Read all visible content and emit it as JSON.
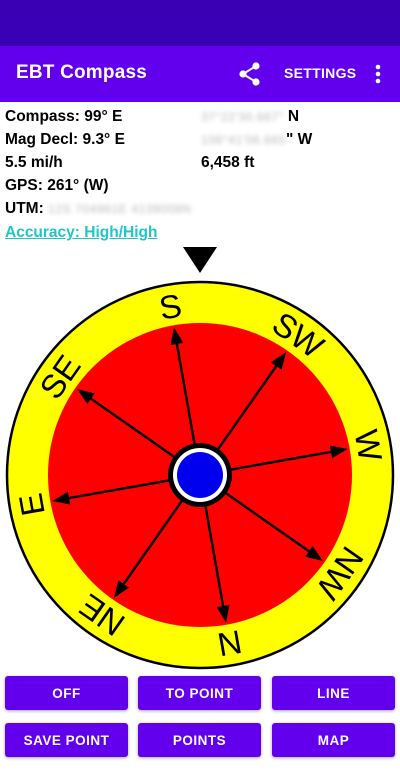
{
  "app": {
    "title": "EBT Compass"
  },
  "toolbar": {
    "settings_label": "SETTINGS",
    "share_icon": "share-icon",
    "more_icon": "more-vert-icon"
  },
  "info": {
    "compass": "Compass: 99° E",
    "mag_decl": "Mag Decl: 9.3° E",
    "speed": "5.5 mi/h",
    "gps": "GPS: 261° (W)",
    "utm_label": "UTM:",
    "utm_value": "12S 704961E 4139008N",
    "latitude_value": "37°22'30.667\"",
    "latitude_dir": "N",
    "longitude_value": "108°41'06.665",
    "longitude_dir": "\" W",
    "altitude": "6,458 ft",
    "accuracy": "Accuracy: High/High"
  },
  "compass": {
    "labels": [
      "E",
      "SE",
      "S",
      "SW",
      "W",
      "NW",
      "N",
      "NE"
    ],
    "heading_deg": 99,
    "colors": {
      "outer_ring": "#ffff00",
      "inner_disk": "#ff0000",
      "center": "#0000ee"
    }
  },
  "buttons": {
    "off": "OFF",
    "to_point": "TO POINT",
    "line": "LINE",
    "save_point": "SAVE POINT",
    "points": "POINTS",
    "map": "MAP"
  },
  "colors": {
    "primary": "#6200ee",
    "status_bar": "#3a00b3",
    "link": "#20c5c5"
  }
}
